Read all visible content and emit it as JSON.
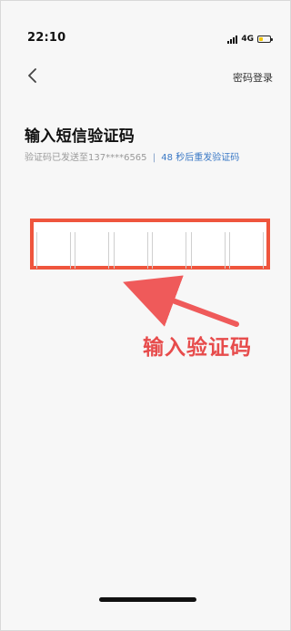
{
  "status_bar": {
    "time": "22:10",
    "network": "4G",
    "battery_level": 0.35,
    "battery_color": "#f3c600"
  },
  "header": {
    "back_icon": "chevron-left-icon",
    "password_login": "密码登录"
  },
  "main": {
    "title": "输入短信验证码",
    "sent_to_prefix": "验证码已发送至",
    "masked_phone": "137****6565",
    "separator": "|",
    "resend_countdown": "48 秒后重发验证码"
  },
  "code_input": {
    "slots": [
      "",
      "",
      "",
      "",
      "",
      ""
    ]
  },
  "annotation": {
    "text": "输入验证码",
    "arrow_color": "#ef5a5a",
    "box_color": "#ef553d"
  }
}
